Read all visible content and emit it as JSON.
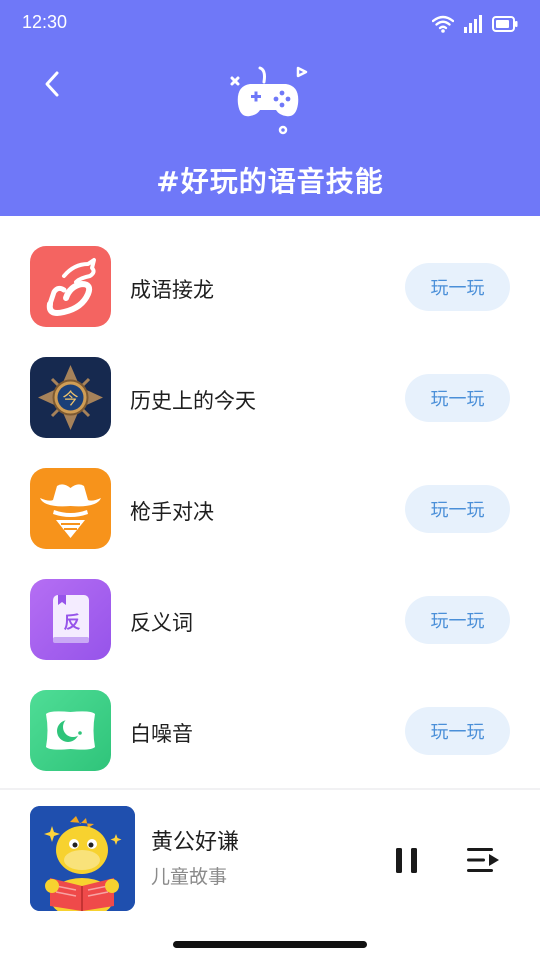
{
  "status": {
    "time": "12:30"
  },
  "header": {
    "title": "#好玩的语音技能",
    "bg_color": "#6f78f8",
    "back_icon": "chevron-left-icon",
    "hero_icon": "gamepad-icon"
  },
  "skills": [
    {
      "name": "成语接龙",
      "button": "玩一玩",
      "icon": "dragon-icon",
      "color": "#f46461"
    },
    {
      "name": "历史上的今天",
      "button": "玩一玩",
      "icon": "compass-icon",
      "color": "#16294f"
    },
    {
      "name": "枪手对决",
      "button": "玩一玩",
      "icon": "cowboy-icon",
      "color": "#f7931b"
    },
    {
      "name": "反义词",
      "button": "玩一玩",
      "icon": "book-icon",
      "color": "#a45ef0"
    },
    {
      "name": "白噪音",
      "button": "玩一玩",
      "icon": "pillow-moon-icon",
      "color": "#3fd088"
    }
  ],
  "player": {
    "title": "黄公好谦",
    "subtitle": "儿童故事",
    "cover_icon": "dinosaur-reading-icon",
    "pause_icon": "pause-icon",
    "queue_icon": "playlist-icon"
  },
  "colors": {
    "button_bg": "#e7f1fc",
    "button_text": "#4a8fd8"
  }
}
